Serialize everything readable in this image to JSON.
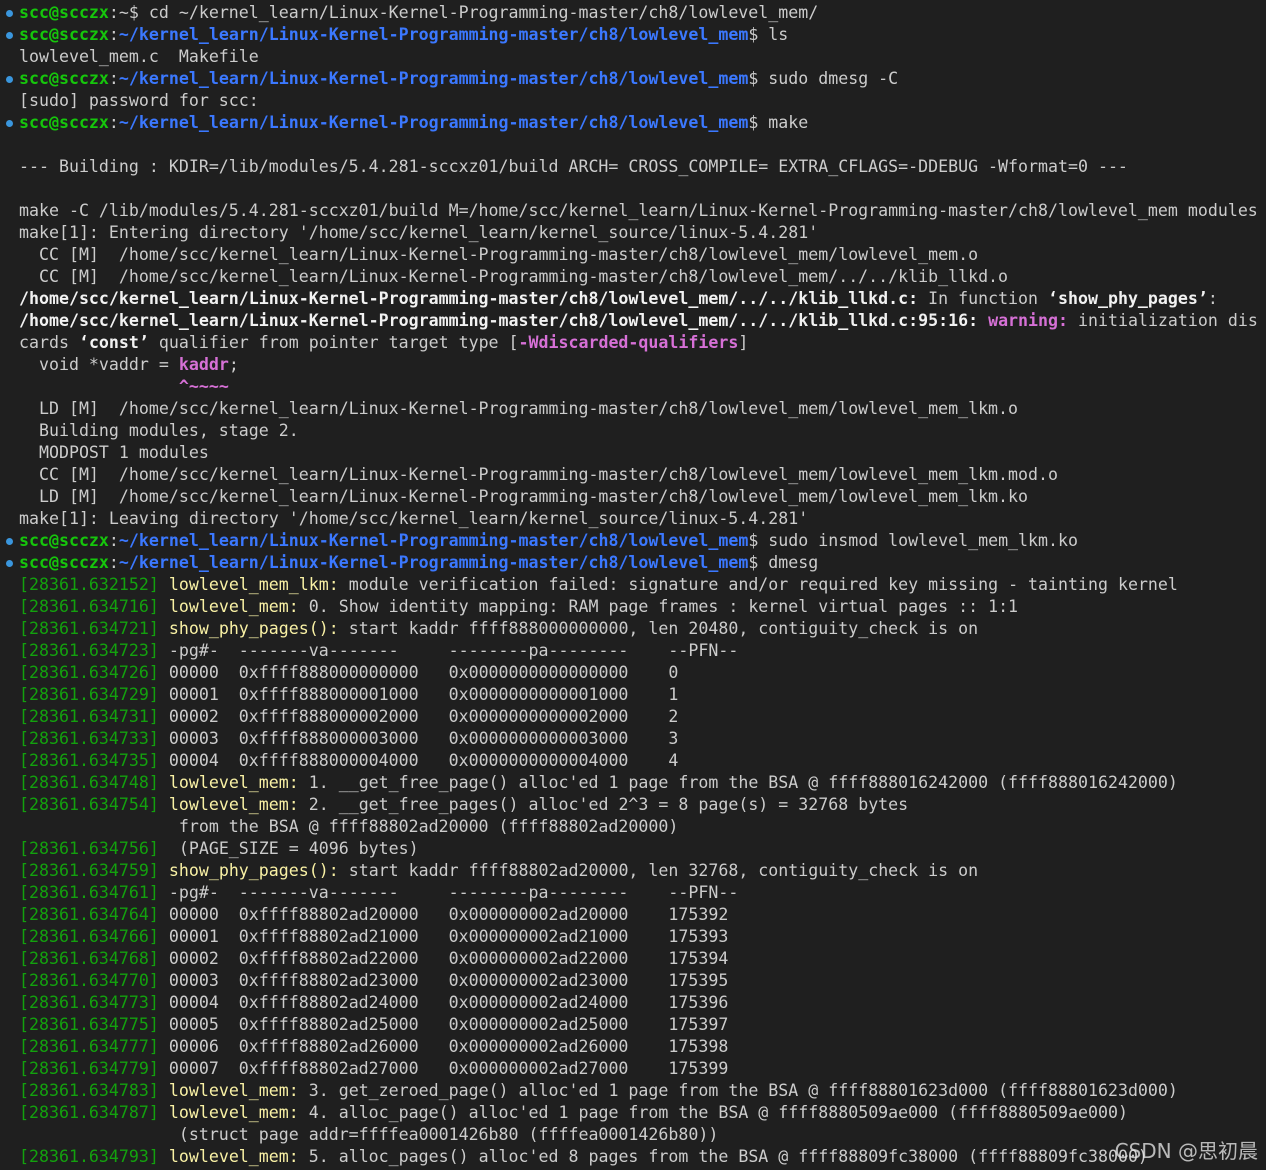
{
  "theme": {
    "background": "#1f1f1f",
    "text": "#cccccc",
    "prompt_user_color": "#16c60c",
    "prompt_path_color": "#3b78ff",
    "timestamp_color": "#13a10e",
    "module_name_color": "#f9f1a5",
    "warning_color": "#d670d6",
    "command_marker_color": "#3a96dd"
  },
  "watermark": "CSDN @思初晨",
  "lines": [
    {
      "marker": true,
      "segs": [
        {
          "t": "scc@scczx",
          "c": "sg"
        },
        {
          "t": ":~$ cd ~/kernel_learn/Linux-Kernel-Programming-master/ch8/lowlevel_mem/",
          "c": ""
        }
      ]
    },
    {
      "marker": true,
      "segs": [
        {
          "t": "scc@scczx",
          "c": "sg"
        },
        {
          "t": ":",
          "c": ""
        },
        {
          "t": "~/kernel_learn/Linux-Kernel-Programming-master/ch8/lowlevel_mem",
          "c": "sb"
        },
        {
          "t": "$ ls",
          "c": ""
        }
      ]
    },
    {
      "marker": false,
      "segs": [
        {
          "t": "lowlevel_mem.c  Makefile",
          "c": ""
        }
      ]
    },
    {
      "marker": true,
      "segs": [
        {
          "t": "scc@scczx",
          "c": "sg"
        },
        {
          "t": ":",
          "c": ""
        },
        {
          "t": "~/kernel_learn/Linux-Kernel-Programming-master/ch8/lowlevel_mem",
          "c": "sb"
        },
        {
          "t": "$ sudo dmesg -C",
          "c": ""
        }
      ]
    },
    {
      "marker": false,
      "segs": [
        {
          "t": "[sudo] password for scc:",
          "c": ""
        }
      ]
    },
    {
      "marker": true,
      "segs": [
        {
          "t": "scc@scczx",
          "c": "sg"
        },
        {
          "t": ":",
          "c": ""
        },
        {
          "t": "~/kernel_learn/Linux-Kernel-Programming-master/ch8/lowlevel_mem",
          "c": "sb"
        },
        {
          "t": "$ make",
          "c": ""
        }
      ]
    },
    {
      "marker": false,
      "segs": []
    },
    {
      "marker": false,
      "segs": [
        {
          "t": "--- Building : KDIR=/lib/modules/5.4.281-sccxz01/build ARCH= CROSS_COMPILE= EXTRA_CFLAGS=-DDEBUG -Wformat=0 ---",
          "c": ""
        }
      ]
    },
    {
      "marker": false,
      "segs": []
    },
    {
      "marker": false,
      "segs": [
        {
          "t": "make -C /lib/modules/5.4.281-sccxz01/build M=/home/scc/kernel_learn/Linux-Kernel-Programming-master/ch8/lowlevel_mem modules",
          "c": ""
        }
      ]
    },
    {
      "marker": false,
      "segs": [
        {
          "t": "make[1]: Entering directory '/home/scc/kernel_learn/kernel_source/linux-5.4.281'",
          "c": ""
        }
      ]
    },
    {
      "marker": false,
      "segs": [
        {
          "t": "  CC [M]  /home/scc/kernel_learn/Linux-Kernel-Programming-master/ch8/lowlevel_mem/lowlevel_mem.o",
          "c": ""
        }
      ]
    },
    {
      "marker": false,
      "segs": [
        {
          "t": "  CC [M]  /home/scc/kernel_learn/Linux-Kernel-Programming-master/ch8/lowlevel_mem/../../klib_llkd.o",
          "c": ""
        }
      ]
    },
    {
      "marker": false,
      "segs": [
        {
          "t": "/home/scc/kernel_learn/Linux-Kernel-Programming-master/ch8/lowlevel_mem/../../klib_llkd.c:",
          "c": "b"
        },
        {
          "t": " In function ",
          "c": ""
        },
        {
          "t": "‘show_phy_pages’",
          "c": "b"
        },
        {
          "t": ":",
          "c": ""
        }
      ]
    },
    {
      "marker": false,
      "segs": [
        {
          "t": "/home/scc/kernel_learn/Linux-Kernel-Programming-master/ch8/lowlevel_mem/../../klib_llkd.c:95:16:",
          "c": "b"
        },
        {
          "t": " ",
          "c": ""
        },
        {
          "t": "warning:",
          "c": "m"
        },
        {
          "t": " initialization dis",
          "c": ""
        }
      ]
    },
    {
      "marker": false,
      "segs": [
        {
          "t": "cards ",
          "c": ""
        },
        {
          "t": "‘const’",
          "c": "b"
        },
        {
          "t": " qualifier from pointer target type [",
          "c": ""
        },
        {
          "t": "-Wdiscarded-qualifiers",
          "c": "m"
        },
        {
          "t": "]",
          "c": ""
        }
      ]
    },
    {
      "marker": false,
      "segs": [
        {
          "t": "  void *vaddr = ",
          "c": ""
        },
        {
          "t": "kaddr",
          "c": "m"
        },
        {
          "t": ";",
          "c": ""
        }
      ]
    },
    {
      "marker": false,
      "segs": [
        {
          "t": "                ",
          "c": ""
        },
        {
          "t": "^~~~~",
          "c": "m"
        }
      ]
    },
    {
      "marker": false,
      "segs": [
        {
          "t": "  LD [M]  /home/scc/kernel_learn/Linux-Kernel-Programming-master/ch8/lowlevel_mem/lowlevel_mem_lkm.o",
          "c": ""
        }
      ]
    },
    {
      "marker": false,
      "segs": [
        {
          "t": "  Building modules, stage 2.",
          "c": ""
        }
      ]
    },
    {
      "marker": false,
      "segs": [
        {
          "t": "  MODPOST 1 modules",
          "c": ""
        }
      ]
    },
    {
      "marker": false,
      "segs": [
        {
          "t": "  CC [M]  /home/scc/kernel_learn/Linux-Kernel-Programming-master/ch8/lowlevel_mem/lowlevel_mem_lkm.mod.o",
          "c": ""
        }
      ]
    },
    {
      "marker": false,
      "segs": [
        {
          "t": "  LD [M]  /home/scc/kernel_learn/Linux-Kernel-Programming-master/ch8/lowlevel_mem/lowlevel_mem_lkm.ko",
          "c": ""
        }
      ]
    },
    {
      "marker": false,
      "segs": [
        {
          "t": "make[1]: Leaving directory '/home/scc/kernel_learn/kernel_source/linux-5.4.281'",
          "c": ""
        }
      ]
    },
    {
      "marker": true,
      "segs": [
        {
          "t": "scc@scczx",
          "c": "sg"
        },
        {
          "t": ":",
          "c": ""
        },
        {
          "t": "~/kernel_learn/Linux-Kernel-Programming-master/ch8/lowlevel_mem",
          "c": "sb"
        },
        {
          "t": "$ sudo insmod lowlevel_mem_lkm.ko",
          "c": ""
        }
      ]
    },
    {
      "marker": true,
      "segs": [
        {
          "t": "scc@scczx",
          "c": "sg"
        },
        {
          "t": ":",
          "c": ""
        },
        {
          "t": "~/kernel_learn/Linux-Kernel-Programming-master/ch8/lowlevel_mem",
          "c": "sb"
        },
        {
          "t": "$ dmesg",
          "c": ""
        }
      ]
    },
    {
      "marker": false,
      "segs": [
        {
          "t": "[28361.632152]",
          "c": "ts"
        },
        {
          "t": " ",
          "c": ""
        },
        {
          "t": "lowlevel_mem_lkm:",
          "c": "y"
        },
        {
          "t": " module verification failed: signature and/or required key missing - tainting kernel",
          "c": ""
        }
      ]
    },
    {
      "marker": false,
      "segs": [
        {
          "t": "[28361.634716]",
          "c": "ts"
        },
        {
          "t": " ",
          "c": ""
        },
        {
          "t": "lowlevel_mem:",
          "c": "y"
        },
        {
          "t": " 0. Show identity mapping: RAM page frames : kernel virtual pages :: 1:1",
          "c": ""
        }
      ]
    },
    {
      "marker": false,
      "segs": [
        {
          "t": "[28361.634721]",
          "c": "ts"
        },
        {
          "t": " ",
          "c": ""
        },
        {
          "t": "show_phy_pages():",
          "c": "y"
        },
        {
          "t": " start kaddr ffff888000000000, len 20480, contiguity_check is on",
          "c": ""
        }
      ]
    },
    {
      "marker": false,
      "segs": [
        {
          "t": "[28361.634723]",
          "c": "ts"
        },
        {
          "t": " -pg#-  -------va-------     --------pa--------    --PFN--",
          "c": ""
        }
      ]
    },
    {
      "marker": false,
      "segs": [
        {
          "t": "[28361.634726]",
          "c": "ts"
        },
        {
          "t": " 00000  0xffff888000000000   0x0000000000000000    0",
          "c": ""
        }
      ]
    },
    {
      "marker": false,
      "segs": [
        {
          "t": "[28361.634729]",
          "c": "ts"
        },
        {
          "t": " 00001  0xffff888000001000   0x0000000000001000    1",
          "c": ""
        }
      ]
    },
    {
      "marker": false,
      "segs": [
        {
          "t": "[28361.634731]",
          "c": "ts"
        },
        {
          "t": " 00002  0xffff888000002000   0x0000000000002000    2",
          "c": ""
        }
      ]
    },
    {
      "marker": false,
      "segs": [
        {
          "t": "[28361.634733]",
          "c": "ts"
        },
        {
          "t": " 00003  0xffff888000003000   0x0000000000003000    3",
          "c": ""
        }
      ]
    },
    {
      "marker": false,
      "segs": [
        {
          "t": "[28361.634735]",
          "c": "ts"
        },
        {
          "t": " 00004  0xffff888000004000   0x0000000000004000    4",
          "c": ""
        }
      ]
    },
    {
      "marker": false,
      "segs": [
        {
          "t": "[28361.634748]",
          "c": "ts"
        },
        {
          "t": " ",
          "c": ""
        },
        {
          "t": "lowlevel_mem:",
          "c": "y"
        },
        {
          "t": " 1. __get_free_page() alloc'ed 1 page from the BSA @ ffff888016242000 (ffff888016242000)",
          "c": ""
        }
      ]
    },
    {
      "marker": false,
      "segs": [
        {
          "t": "[28361.634754]",
          "c": "ts"
        },
        {
          "t": " ",
          "c": ""
        },
        {
          "t": "lowlevel_mem:",
          "c": "y"
        },
        {
          "t": " 2. __get_free_pages() alloc'ed 2^3 = 8 page(s) = 32768 bytes",
          "c": ""
        }
      ]
    },
    {
      "marker": false,
      "segs": [
        {
          "t": "                from the BSA @ ffff88802ad20000 (ffff88802ad20000)",
          "c": ""
        }
      ]
    },
    {
      "marker": false,
      "segs": [
        {
          "t": "[28361.634756]",
          "c": "ts"
        },
        {
          "t": "  (PAGE_SIZE = 4096 bytes)",
          "c": ""
        }
      ]
    },
    {
      "marker": false,
      "segs": [
        {
          "t": "[28361.634759]",
          "c": "ts"
        },
        {
          "t": " ",
          "c": ""
        },
        {
          "t": "show_phy_pages():",
          "c": "y"
        },
        {
          "t": " start kaddr ffff88802ad20000, len 32768, contiguity_check is on",
          "c": ""
        }
      ]
    },
    {
      "marker": false,
      "segs": [
        {
          "t": "[28361.634761]",
          "c": "ts"
        },
        {
          "t": " -pg#-  -------va-------     --------pa--------    --PFN--",
          "c": ""
        }
      ]
    },
    {
      "marker": false,
      "segs": [
        {
          "t": "[28361.634764]",
          "c": "ts"
        },
        {
          "t": " 00000  0xffff88802ad20000   0x000000002ad20000    175392",
          "c": ""
        }
      ]
    },
    {
      "marker": false,
      "segs": [
        {
          "t": "[28361.634766]",
          "c": "ts"
        },
        {
          "t": " 00001  0xffff88802ad21000   0x000000002ad21000    175393",
          "c": ""
        }
      ]
    },
    {
      "marker": false,
      "segs": [
        {
          "t": "[28361.634768]",
          "c": "ts"
        },
        {
          "t": " 00002  0xffff88802ad22000   0x000000002ad22000    175394",
          "c": ""
        }
      ]
    },
    {
      "marker": false,
      "segs": [
        {
          "t": "[28361.634770]",
          "c": "ts"
        },
        {
          "t": " 00003  0xffff88802ad23000   0x000000002ad23000    175395",
          "c": ""
        }
      ]
    },
    {
      "marker": false,
      "segs": [
        {
          "t": "[28361.634773]",
          "c": "ts"
        },
        {
          "t": " 00004  0xffff88802ad24000   0x000000002ad24000    175396",
          "c": ""
        }
      ]
    },
    {
      "marker": false,
      "segs": [
        {
          "t": "[28361.634775]",
          "c": "ts"
        },
        {
          "t": " 00005  0xffff88802ad25000   0x000000002ad25000    175397",
          "c": ""
        }
      ]
    },
    {
      "marker": false,
      "segs": [
        {
          "t": "[28361.634777]",
          "c": "ts"
        },
        {
          "t": " 00006  0xffff88802ad26000   0x000000002ad26000    175398",
          "c": ""
        }
      ]
    },
    {
      "marker": false,
      "segs": [
        {
          "t": "[28361.634779]",
          "c": "ts"
        },
        {
          "t": " 00007  0xffff88802ad27000   0x000000002ad27000    175399",
          "c": ""
        }
      ]
    },
    {
      "marker": false,
      "segs": [
        {
          "t": "[28361.634783]",
          "c": "ts"
        },
        {
          "t": " ",
          "c": ""
        },
        {
          "t": "lowlevel_mem:",
          "c": "y"
        },
        {
          "t": " 3. get_zeroed_page() alloc'ed 1 page from the BSA @ ffff88801623d000 (ffff88801623d000)",
          "c": ""
        }
      ]
    },
    {
      "marker": false,
      "segs": [
        {
          "t": "[28361.634787]",
          "c": "ts"
        },
        {
          "t": " ",
          "c": ""
        },
        {
          "t": "lowlevel_mem:",
          "c": "y"
        },
        {
          "t": " 4. alloc_page() alloc'ed 1 page from the BSA @ ffff8880509ae000 (ffff8880509ae000)",
          "c": ""
        }
      ]
    },
    {
      "marker": false,
      "segs": [
        {
          "t": "                (struct page addr=ffffea0001426b80 (ffffea0001426b80))",
          "c": ""
        }
      ]
    },
    {
      "marker": false,
      "segs": [
        {
          "t": "[28361.634793]",
          "c": "ts"
        },
        {
          "t": " ",
          "c": ""
        },
        {
          "t": "lowlevel_mem:",
          "c": "y"
        },
        {
          "t": " 5. alloc_pages() alloc'ed 8 pages from the BSA @ ffff88809fc38000 (ffff88809fc38000)",
          "c": ""
        }
      ]
    }
  ]
}
